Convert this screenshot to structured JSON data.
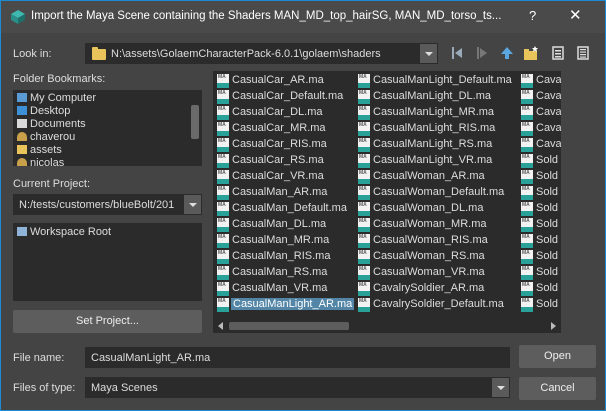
{
  "window": {
    "title": "Import the Maya Scene containing the Shaders MAN_MD_top_hairSG, MAN_MD_torso_ts...",
    "help": "?",
    "close": "✕"
  },
  "lookin": {
    "label": "Look in:",
    "path": "N:\\assets\\GolaemCharacterPack-6.0.1\\golaem\\shaders"
  },
  "bookmarks": {
    "label": "Folder Bookmarks:",
    "items": [
      {
        "label": "My Computer",
        "color": "#5b9bd5"
      },
      {
        "label": "Desktop",
        "color": "#3d8fd6"
      },
      {
        "label": "Documents",
        "color": "#d9d9d9"
      },
      {
        "label": "chaverou",
        "color": "#c8a04a"
      },
      {
        "label": "assets",
        "color": "#e8c45a"
      },
      {
        "label": "nicolas",
        "color": "#c8a04a"
      }
    ]
  },
  "project": {
    "label": "Current Project:",
    "value": "N:/tests/customers/blueBolt/201",
    "root": "Workspace Root",
    "set_button": "Set Project..."
  },
  "files": {
    "icon_text": "MA",
    "columns": [
      [
        "CasualCar_AR.ma",
        "CasualCar_Default.ma",
        "CasualCar_DL.ma",
        "CasualCar_MR.ma",
        "CasualCar_RIS.ma",
        "CasualCar_RS.ma",
        "CasualCar_VR.ma",
        "CasualMan_AR.ma",
        "CasualMan_Default.ma",
        "CasualMan_DL.ma",
        "CasualMan_MR.ma",
        "CasualMan_RIS.ma",
        "CasualMan_RS.ma",
        "CasualMan_VR.ma",
        "CasualManLight_AR.ma"
      ],
      [
        "CasualManLight_Default.ma",
        "CasualManLight_DL.ma",
        "CasualManLight_MR.ma",
        "CasualManLight_RIS.ma",
        "CasualManLight_RS.ma",
        "CasualManLight_VR.ma",
        "CasualWoman_AR.ma",
        "CasualWoman_Default.ma",
        "CasualWoman_DL.ma",
        "CasualWoman_MR.ma",
        "CasualWoman_RIS.ma",
        "CasualWoman_RS.ma",
        "CasualWoman_VR.ma",
        "CavalrySoldier_AR.ma",
        "CavalrySoldier_Default.ma"
      ],
      [
        "Cava",
        "Cava",
        "Cava",
        "Cava",
        "Cava",
        "Sold",
        "Sold",
        "Sold",
        "Sold",
        "Sold",
        "Sold",
        "Sold",
        "Sold",
        "Sold",
        "Sold"
      ]
    ],
    "selected": "CasualManLight_AR.ma"
  },
  "footer": {
    "filename_label": "File name:",
    "filename_value": "CasualManLight_AR.ma",
    "filetype_label": "Files of type:",
    "filetype_value": "Maya Scenes",
    "open": "Open",
    "cancel": "Cancel"
  },
  "colors": {
    "accent": "#1f8ad4",
    "selection": "#5285a6",
    "panel": "#2b2b2b"
  }
}
